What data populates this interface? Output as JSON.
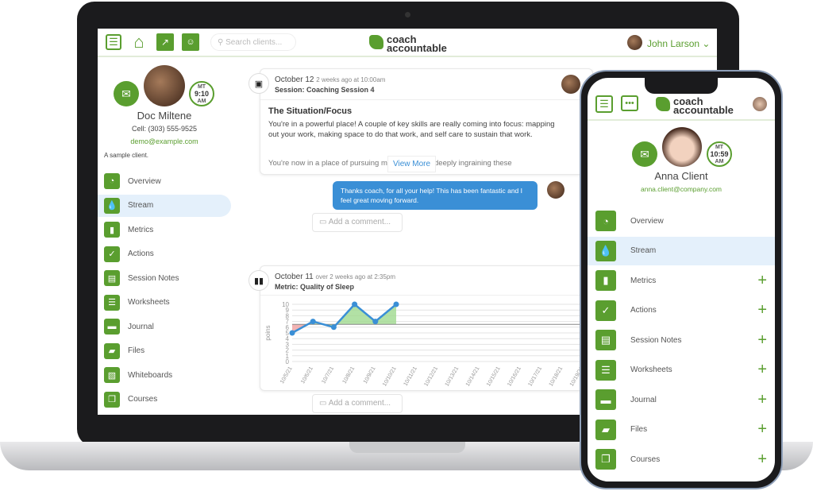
{
  "laptop": {
    "header": {
      "search_placeholder": "Search clients...",
      "logo_line1": "coach",
      "logo_line2": "accountable",
      "user_name": "John Larson"
    },
    "client": {
      "name": "Doc Miltene",
      "cell": "Cell:  (303) 555-9525",
      "email": "demo@example.com",
      "note": "A sample client.",
      "tz": "MT",
      "time": "9:10",
      "ampm": "AM"
    },
    "sidebar": {
      "items": [
        {
          "label": "Overview",
          "icon": "overview-icon"
        },
        {
          "label": "Stream",
          "icon": "stream-icon",
          "active": true
        },
        {
          "label": "Metrics",
          "icon": "metrics-icon"
        },
        {
          "label": "Actions",
          "icon": "check-icon"
        },
        {
          "label": "Session Notes",
          "icon": "session-notes-icon"
        },
        {
          "label": "Worksheets",
          "icon": "worksheet-icon"
        },
        {
          "label": "Journal",
          "icon": "journal-icon"
        },
        {
          "label": "Files",
          "icon": "folder-icon"
        },
        {
          "label": "Whiteboards",
          "icon": "whiteboard-icon"
        },
        {
          "label": "Courses",
          "icon": "courses-icon"
        }
      ]
    },
    "stream": {
      "session": {
        "date": "October 12",
        "ago": "2 weeks ago at 10:00am",
        "title": "Session: Coaching Session 4",
        "heading": "The Situation/Focus",
        "para1": "You're in a powerful place!  A couple of key skills are really coming into focus: mapping out your work, making space to do that work, and self care to sustain that work.",
        "para2": "You're now in a place of pursuing more and more deeply ingraining these",
        "view_more": "View More",
        "reply": "Thanks coach, for all your help!  This has been fantastic and I feel great moving forward.",
        "comment_placeholder": "Add a comment..."
      },
      "metric": {
        "date": "October 11",
        "ago": "over 2 weeks ago at 2:35pm",
        "title": "Metric: Quality of Sleep",
        "comment_placeholder": "Add a comment..."
      }
    }
  },
  "chart_data": {
    "type": "line",
    "ylabel": "poins",
    "ylim": [
      0,
      10
    ],
    "yticks": [
      0,
      1,
      2,
      3,
      4,
      5,
      6,
      7,
      8,
      9,
      10
    ],
    "categories": [
      "10/5/21",
      "10/6/21",
      "10/7/21",
      "10/8/21",
      "10/9/21",
      "10/10/21",
      "10/11/21",
      "10/12/21",
      "10/13/21",
      "10/14/21",
      "10/15/21",
      "10/16/21",
      "10/17/21",
      "10/18/21",
      "10/19/21"
    ],
    "values": [
      5,
      7,
      6,
      10,
      7,
      10
    ],
    "target": 6.5,
    "colors": {
      "line": "#3a8fd6",
      "above": "#9fd98e",
      "below": "#f2b3b3",
      "target": "#888888"
    },
    "grid": true
  },
  "phone": {
    "header": {
      "logo_line1": "coach",
      "logo_line2": "accountable"
    },
    "client": {
      "name": "Anna Client",
      "email": "anna.client@company.com",
      "tz": "MT",
      "time": "10:59",
      "ampm": "AM"
    },
    "items": [
      {
        "label": "Overview"
      },
      {
        "label": "Stream",
        "active": true
      },
      {
        "label": "Metrics",
        "plus": "+"
      },
      {
        "label": "Actions",
        "plus": "+"
      },
      {
        "label": "Session Notes",
        "plus": "+"
      },
      {
        "label": "Worksheets",
        "plus": "+"
      },
      {
        "label": "Journal",
        "plus": "+"
      },
      {
        "label": "Files",
        "plus": "+"
      },
      {
        "label": "Courses",
        "plus": "+"
      }
    ]
  },
  "colors": {
    "brand": "#5a9e2f",
    "accent": "#3a8fd6"
  }
}
